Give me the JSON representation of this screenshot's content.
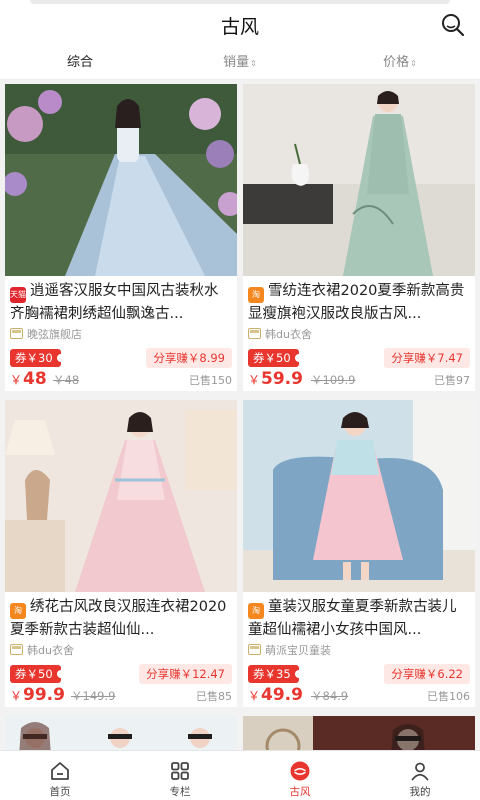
{
  "header": {
    "title": "古风"
  },
  "sort_tabs": [
    {
      "label": "综合",
      "arrow": ""
    },
    {
      "label": "销量",
      "arrow": "⇕"
    },
    {
      "label": "价格",
      "arrow": "⇕"
    }
  ],
  "products": [
    {
      "platform": "天猫",
      "platform_color": "#e0242c",
      "title": "逍遥客汉服女中国风古装秋水齐胸襦裙刺绣超仙飘逸古...",
      "shop": "晚弦旗舰店",
      "coupon": "券￥30",
      "share": "分享赚￥8.99",
      "price_currency": "￥",
      "price": "48",
      "orig_price": "￥48",
      "sold": "已售150"
    },
    {
      "platform": "淘",
      "platform_color": "#f5871f",
      "title": "雪纺连衣裙2020夏季新款高贵显瘦旗袍汉服改良版古风...",
      "shop": "韩du衣舍",
      "coupon": "券￥50",
      "share": "分享赚￥7.47",
      "price_currency": "￥",
      "price": "59.9",
      "orig_price": "￥109.9",
      "sold": "已售97"
    },
    {
      "platform": "淘",
      "platform_color": "#f5871f",
      "title": "绣花古风改良汉服连衣裙2020夏季新款古装超仙仙...",
      "shop": "韩du衣舍",
      "coupon": "券￥50",
      "share": "分享赚￥12.47",
      "price_currency": "￥",
      "price": "99.9",
      "orig_price": "￥149.9",
      "sold": "已售85"
    },
    {
      "platform": "淘",
      "platform_color": "#f5871f",
      "title": "童装汉服女童夏季新款古装儿童超仙襦裙小女孩中国风...",
      "shop": "萌派宝贝童装",
      "coupon": "券￥35",
      "share": "分享赚￥6.22",
      "price_currency": "￥",
      "price": "49.9",
      "orig_price": "￥84.9",
      "sold": "已售106"
    }
  ],
  "tabbar": [
    {
      "label": "首页",
      "icon": "home-icon"
    },
    {
      "label": "专栏",
      "icon": "grid-icon"
    },
    {
      "label": "古风",
      "icon": "guofeng-icon"
    },
    {
      "label": "我的",
      "icon": "user-icon"
    }
  ],
  "colors": {
    "accent": "#e8362e",
    "tmall": "#e0242c",
    "taobao": "#f5871f"
  }
}
